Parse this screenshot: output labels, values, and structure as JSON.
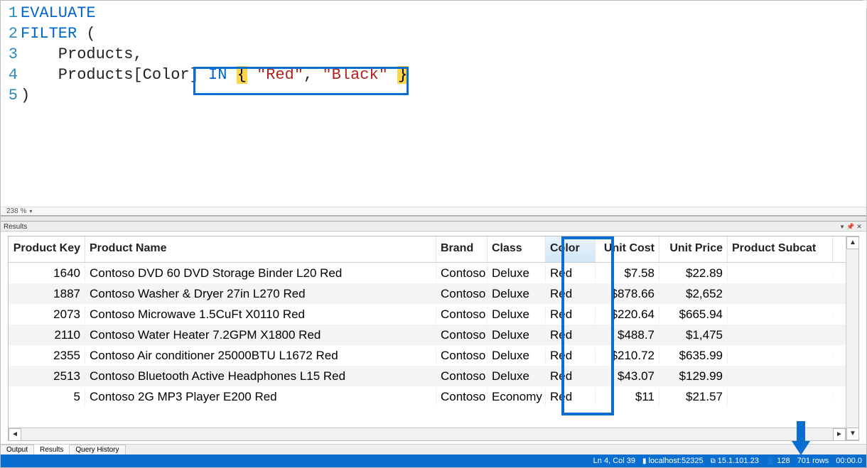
{
  "editor": {
    "zoom_label": "238 %",
    "lines": {
      "l1": "EVALUATE",
      "l2_kw": "FILTER",
      "l2_rest": " (",
      "l3": "    Products,",
      "l4_prefix": "    Products[Color] ",
      "l4_in": "IN",
      "l4_space1": " ",
      "l4_brace_open": "{",
      "l4_mid1": " ",
      "l4_str1": "\"Red\"",
      "l4_comma": ", ",
      "l4_str2": "\"Black\"",
      "l4_mid2": " ",
      "l4_brace_close": "}",
      "l5": ")"
    },
    "line_numbers": {
      "n1": "1",
      "n2": "2",
      "n3": "3",
      "n4": "4",
      "n5": "5"
    }
  },
  "results": {
    "panel_title": "Results",
    "columns": {
      "key": "Product Key",
      "name": "Product Name",
      "brand": "Brand",
      "class": "Class",
      "color": "Color",
      "ucost": "Unit Cost",
      "uprice": "Unit Price",
      "subcat": "Product Subcat"
    },
    "rows": [
      {
        "key": "1640",
        "name": "Contoso DVD 60 DVD Storage Binder L20 Red",
        "brand": "Contoso",
        "class": "Deluxe",
        "color": "Red",
        "ucost": "$7.58",
        "uprice": "$22.89",
        "subcat": ""
      },
      {
        "key": "1887",
        "name": "Contoso Washer & Dryer 27in L270 Red",
        "brand": "Contoso",
        "class": "Deluxe",
        "color": "Red",
        "ucost": "$878.66",
        "uprice": "$2,652",
        "subcat": ""
      },
      {
        "key": "2073",
        "name": "Contoso Microwave 1.5CuFt X0110 Red",
        "brand": "Contoso",
        "class": "Deluxe",
        "color": "Red",
        "ucost": "$220.64",
        "uprice": "$665.94",
        "subcat": ""
      },
      {
        "key": "2110",
        "name": "Contoso Water Heater 7.2GPM X1800 Red",
        "brand": "Contoso",
        "class": "Deluxe",
        "color": "Red",
        "ucost": "$488.7",
        "uprice": "$1,475",
        "subcat": ""
      },
      {
        "key": "2355",
        "name": "Contoso Air conditioner 25000BTU L1672 Red",
        "brand": "Contoso",
        "class": "Deluxe",
        "color": "Red",
        "ucost": "$210.72",
        "uprice": "$635.99",
        "subcat": ""
      },
      {
        "key": "2513",
        "name": "Contoso Bluetooth Active Headphones L15 Red",
        "brand": "Contoso",
        "class": "Deluxe",
        "color": "Red",
        "ucost": "$43.07",
        "uprice": "$129.99",
        "subcat": ""
      },
      {
        "key": "5",
        "name": "Contoso 2G MP3 Player E200 Red",
        "brand": "Contoso",
        "class": "Economy",
        "color": "Red",
        "ucost": "$11",
        "uprice": "$21.57",
        "subcat": ""
      }
    ]
  },
  "tabs": {
    "output": "Output",
    "results": "Results",
    "history": "Query History"
  },
  "status": {
    "pos": "Ln 4, Col 39",
    "server": "localhost:52325",
    "version": "15.1.101.23",
    "user": "128",
    "rows": "701 rows",
    "time": "00:00.0"
  }
}
